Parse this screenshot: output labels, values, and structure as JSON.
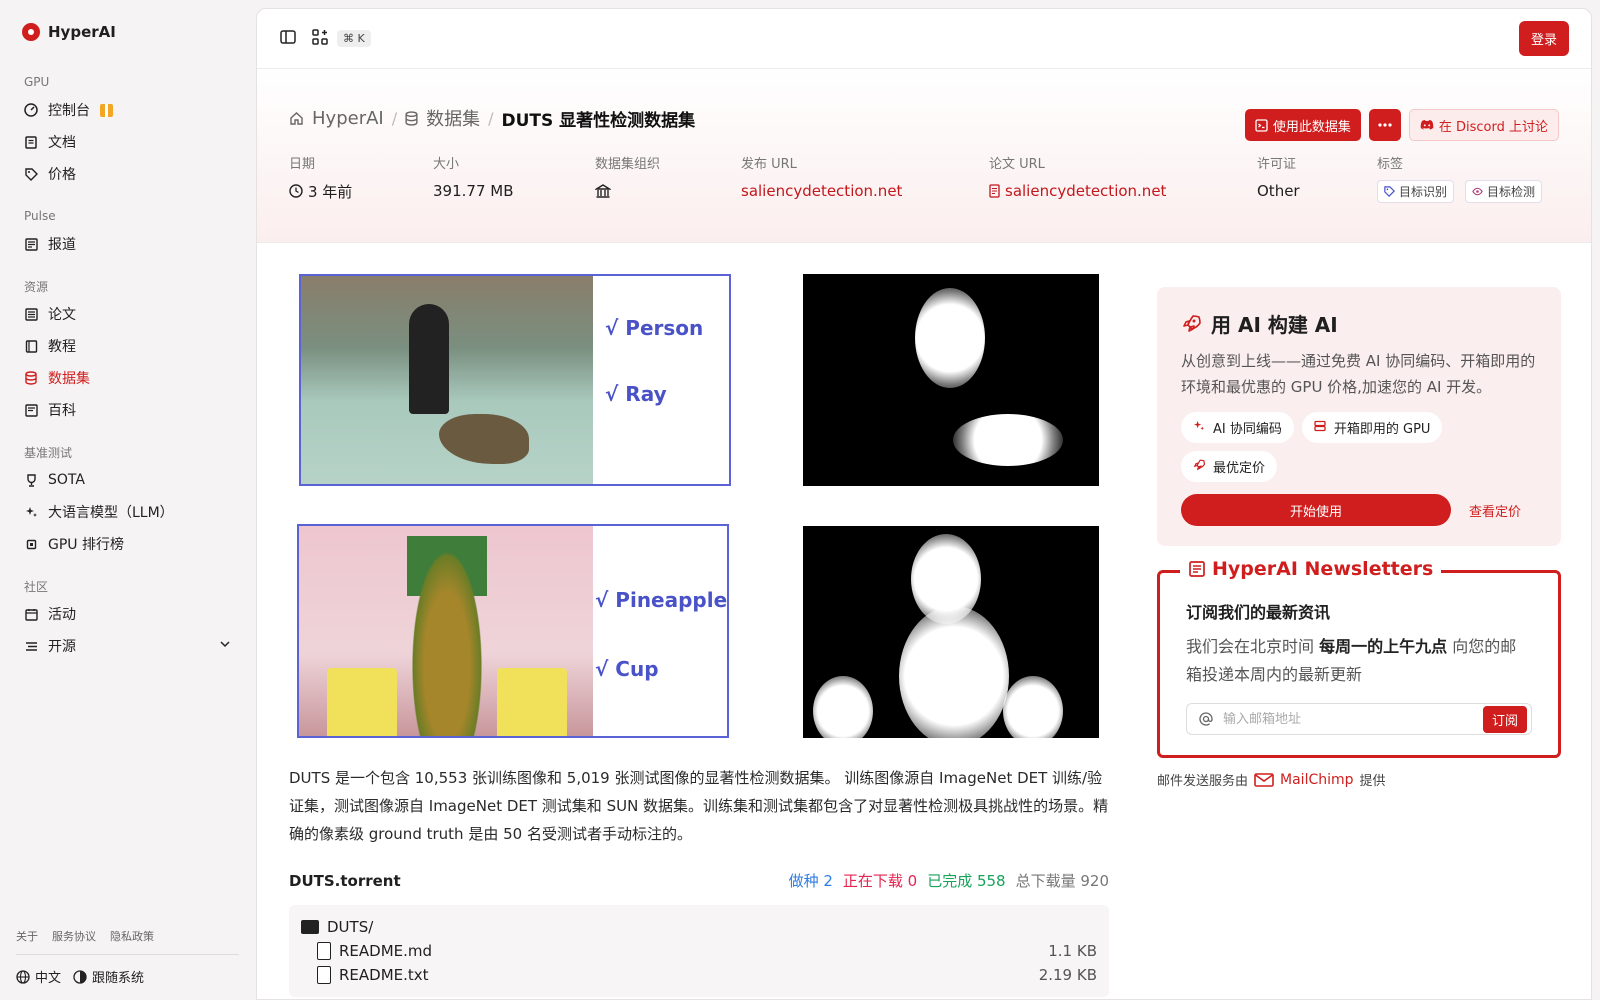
{
  "brand": {
    "name": "HyperAI"
  },
  "sidebar": {
    "sections": [
      {
        "label": "GPU",
        "items": [
          {
            "label": "控制台",
            "icon": "gauge-icon",
            "gift": true
          },
          {
            "label": "文档",
            "icon": "doc-icon"
          },
          {
            "label": "价格",
            "icon": "tag-icon"
          }
        ]
      },
      {
        "label": "Pulse",
        "items": [
          {
            "label": "报道",
            "icon": "newspaper-icon"
          }
        ]
      },
      {
        "label": "资源",
        "items": [
          {
            "label": "论文",
            "icon": "paper-icon"
          },
          {
            "label": "教程",
            "icon": "book-icon"
          },
          {
            "label": "数据集",
            "icon": "database-icon",
            "active": true
          },
          {
            "label": "百科",
            "icon": "encyclopedia-icon"
          }
        ]
      },
      {
        "label": "基准测试",
        "items": [
          {
            "label": "SOTA",
            "icon": "trophy-icon"
          },
          {
            "label": "大语言模型（LLM）",
            "icon": "sparkle-icon"
          },
          {
            "label": "GPU 排行榜",
            "icon": "chip-icon"
          }
        ]
      },
      {
        "label": "社区",
        "items": [
          {
            "label": "活动",
            "icon": "calendar-icon"
          },
          {
            "label": "开源",
            "icon": "list-icon",
            "chevron": true
          }
        ]
      }
    ],
    "footer_links": [
      "关于",
      "服务协议",
      "隐私政策"
    ],
    "language": "中文",
    "theme": "跟随系统"
  },
  "topbar": {
    "shortcut": "⌘ K",
    "login": "登录"
  },
  "breadcrumb": {
    "home": "HyperAI",
    "section": "数据集",
    "current": "DUTS 显著性检测数据集"
  },
  "actions": {
    "use_dataset": "使用此数据集",
    "discord": "在 Discord 上讨论"
  },
  "meta": {
    "date_label": "日期",
    "date": "3 年前",
    "size_label": "大小",
    "size": "391.77 MB",
    "org_label": "数据集组织",
    "pub_label": "发布 URL",
    "pub_url": "saliencydetection.net",
    "paper_label": "论文 URL",
    "paper_url": "saliencydetection.net",
    "license_label": "许可证",
    "license": "Other",
    "tags_label": "标签",
    "tags": [
      "目标识别",
      "目标检测"
    ]
  },
  "figure": {
    "labels": [
      "√ Person",
      "√ Ray",
      "√ Pineapple",
      "√ Cup"
    ]
  },
  "description": "DUTS 是一个包含 10,553 张训练图像和 5,019 张测试图像的显著性检测数据集。 训练图像源自 ImageNet DET 训练/验证集，测试图像源自 ImageNet DET 测试集和 SUN 数据集。训练集和测试集都包含了对显著性检测极具挑战性的场景。精确的像素级 ground truth 是由 50 名受测试者手动标注的。",
  "torrent": {
    "name": "DUTS.torrent",
    "seeding": "做种 2",
    "downloading": "正在下载 0",
    "completed": "已完成 558",
    "total": "总下载量 920",
    "files": [
      {
        "name": "DUTS/",
        "type": "folder",
        "size": ""
      },
      {
        "name": "README.md",
        "type": "file",
        "size": "1.1 KB"
      },
      {
        "name": "README.txt",
        "type": "file",
        "size": "2.19 KB"
      }
    ]
  },
  "promo": {
    "title": "用 AI 构建 AI",
    "text": "从创意到上线——通过免费 AI 协同编码、开箱即用的环境和最优惠的 GPU 价格,加速您的 AI 开发。",
    "chips": [
      "AI 协同编码",
      "开箱即用的 GPU",
      "最优定价"
    ],
    "start": "开始使用",
    "pricing": "查看定价"
  },
  "newsletter": {
    "title": "HyperAI Newsletters",
    "heading": "订阅我们的最新资讯",
    "text_pre": "我们会在北京时间",
    "text_bold": "每周一的上午九点",
    "text_post": "向您的邮箱投递本周内的最新更新",
    "placeholder": "输入邮箱地址",
    "subscribe": "订阅",
    "provider_pre": "邮件发送服务由",
    "provider": "MailChimp",
    "provider_post": "提供"
  },
  "colors": {
    "accent": "#d01e1e",
    "seeding": "#2f7de1",
    "downloading": "#e5244f",
    "completed": "#16a35a"
  }
}
